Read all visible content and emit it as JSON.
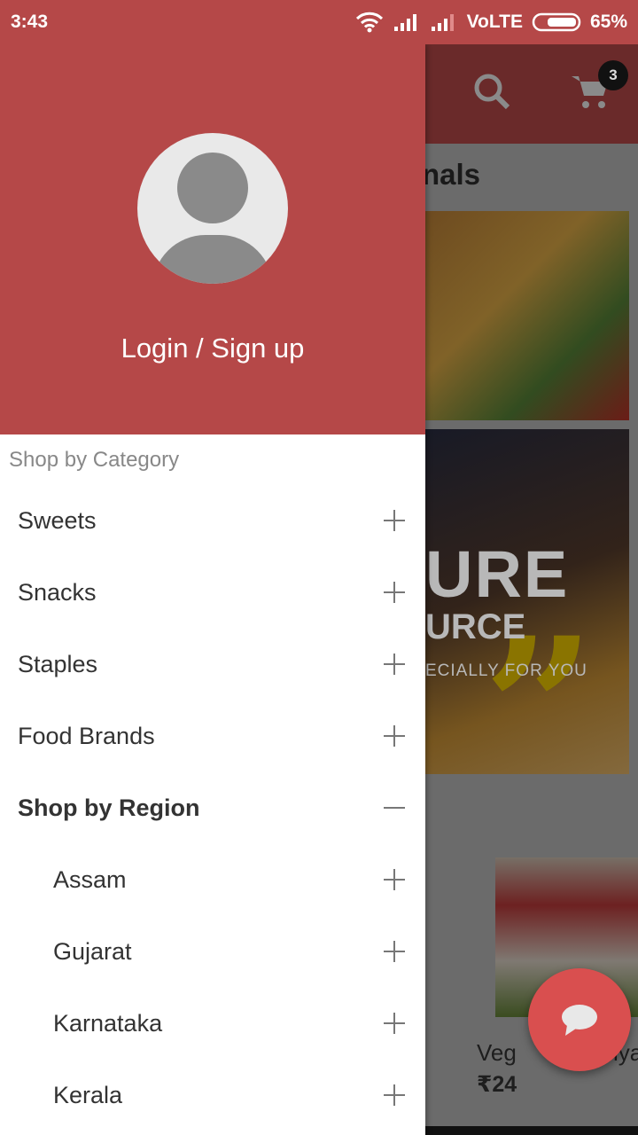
{
  "status_bar": {
    "time": "3:43",
    "network": "VoLTE",
    "battery": "65%",
    "battery_level": 65,
    "icons": [
      "wifi-icon",
      "signal-icon",
      "signal-icon",
      "battery-icon"
    ]
  },
  "background": {
    "cart_count": "3",
    "section_title_partial": "nals",
    "banner_line1": "URE",
    "banner_line2": "URCE",
    "banner_line3": "ECIALLY FOR YOU",
    "banner_quote": "”",
    "product_name_left": "Veg",
    "product_name_right": "iya",
    "product_price": "₹24"
  },
  "drawer": {
    "login_label": "Login / Sign up",
    "category_header": "Shop by Category",
    "items": [
      {
        "label": "Sweets",
        "state": "collapsed"
      },
      {
        "label": "Snacks",
        "state": "collapsed"
      },
      {
        "label": "Staples",
        "state": "collapsed"
      },
      {
        "label": "Food Brands",
        "state": "collapsed"
      },
      {
        "label": "Shop by Region",
        "state": "expanded"
      },
      {
        "label": "Assam",
        "state": "collapsed",
        "level": 2
      },
      {
        "label": "Gujarat",
        "state": "collapsed",
        "level": 2
      },
      {
        "label": "Karnataka",
        "state": "collapsed",
        "level": 2
      },
      {
        "label": "Kerala",
        "state": "collapsed",
        "level": 2
      }
    ]
  },
  "colors": {
    "primary": "#b54848",
    "fab": "#d94f4f"
  }
}
